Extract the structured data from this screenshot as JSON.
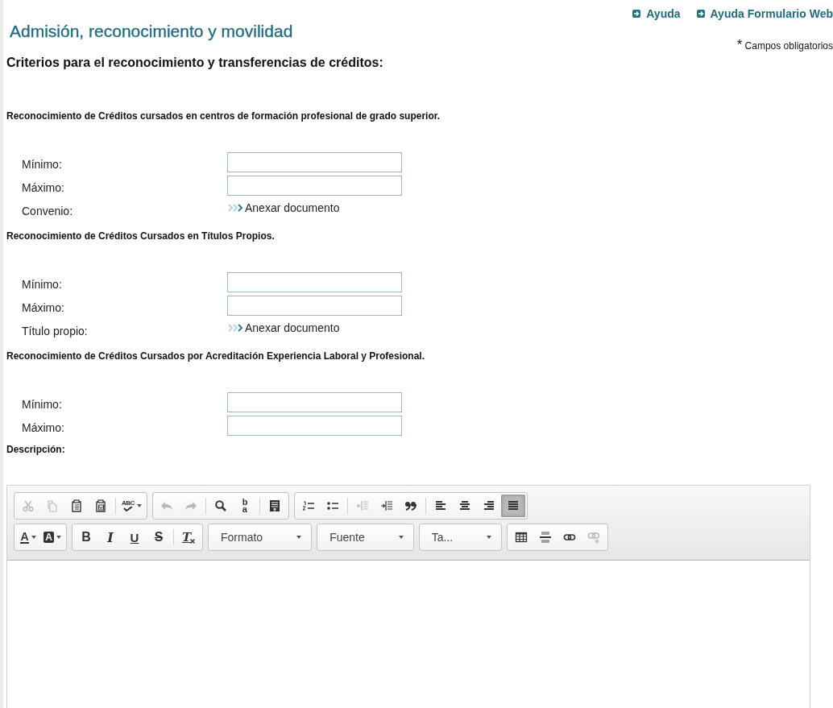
{
  "header": {
    "title": "Admisión, reconocimiento y movilidad",
    "links": [
      {
        "label": "Ayuda"
      },
      {
        "label": "Ayuda Formulario Web"
      }
    ],
    "required_note": {
      "mark": "*",
      "text": "Campos obligatorios"
    },
    "subtitle": "Criterios para el reconocimiento y transferencias de créditos:"
  },
  "sections": [
    {
      "heading": "Reconocimiento de Créditos cursados en centros de formación profesional de grado superior.",
      "fields": [
        {
          "label": "Mínimo:",
          "kind": "input"
        },
        {
          "label": "Máximo:",
          "kind": "input"
        },
        {
          "label": "Convenio:",
          "kind": "attach",
          "action": "Anexar documento"
        }
      ]
    },
    {
      "heading": "Reconocimiento de Créditos Cursados en Títulos Propios.",
      "fields": [
        {
          "label": "Mínimo:",
          "kind": "input"
        },
        {
          "label": "Máximo:",
          "kind": "input"
        },
        {
          "label": "Título propio:",
          "kind": "attach",
          "action": "Anexar documento"
        }
      ]
    },
    {
      "heading": "Reconocimiento de Créditos Cursados por Acreditación Experiencia Laboral y Profesional.",
      "fields": [
        {
          "label": "Mínimo:",
          "kind": "input"
        },
        {
          "label": "Máximo:",
          "kind": "input"
        }
      ]
    }
  ],
  "description_label": "Descripción:",
  "editor": {
    "toolbar_rows": [
      [
        [
          {
            "kind": "cut",
            "disabled": true
          },
          {
            "kind": "copy",
            "disabled": true
          },
          {
            "kind": "paste",
            "disabled": false
          },
          {
            "kind": "paste-word",
            "disabled": false
          },
          {
            "kind": "separator"
          },
          {
            "kind": "spell",
            "disabled": false,
            "label": "ABC",
            "dropdown": true
          }
        ],
        [
          {
            "kind": "undo",
            "disabled": true
          },
          {
            "kind": "redo",
            "disabled": true
          },
          {
            "kind": "separator"
          },
          {
            "kind": "find",
            "disabled": false
          },
          {
            "kind": "replace",
            "disabled": false,
            "label": "ba"
          },
          {
            "kind": "separator"
          },
          {
            "kind": "blocks",
            "disabled": false
          }
        ],
        [
          {
            "kind": "numbered",
            "disabled": false
          },
          {
            "kind": "bulleted",
            "disabled": false
          },
          {
            "kind": "separator"
          },
          {
            "kind": "outdent",
            "disabled": true
          },
          {
            "kind": "indent",
            "disabled": false
          },
          {
            "kind": "quote",
            "disabled": false
          },
          {
            "kind": "separator"
          },
          {
            "kind": "align-left",
            "disabled": false,
            "selected": false
          },
          {
            "kind": "align-center",
            "disabled": false,
            "selected": false
          },
          {
            "kind": "align-right",
            "disabled": false,
            "selected": false
          },
          {
            "kind": "justify",
            "disabled": false,
            "selected": true
          }
        ]
      ],
      [
        [
          {
            "kind": "text-color",
            "disabled": false,
            "label": "A",
            "dropdown": true
          },
          {
            "kind": "bg-color",
            "disabled": false,
            "label": "A",
            "dropdown": true
          }
        ],
        [
          {
            "kind": "bold",
            "disabled": false,
            "label": "B"
          },
          {
            "kind": "italic",
            "disabled": false,
            "label": "I"
          },
          {
            "kind": "underline",
            "disabled": false,
            "label": "U"
          },
          {
            "kind": "strike",
            "disabled": false,
            "label": "S"
          },
          {
            "kind": "separator"
          },
          {
            "kind": "remove-format",
            "disabled": false,
            "label": "T"
          }
        ],
        [
          {
            "kind": "combo",
            "label": "Formato"
          }
        ],
        [
          {
            "kind": "combo",
            "label": "Fuente"
          }
        ],
        [
          {
            "kind": "combo",
            "label": "Ta..."
          }
        ],
        [
          {
            "kind": "table",
            "disabled": false
          },
          {
            "kind": "hrule",
            "disabled": false
          },
          {
            "kind": "link",
            "disabled": false
          },
          {
            "kind": "unlink",
            "disabled": true
          }
        ]
      ]
    ]
  }
}
